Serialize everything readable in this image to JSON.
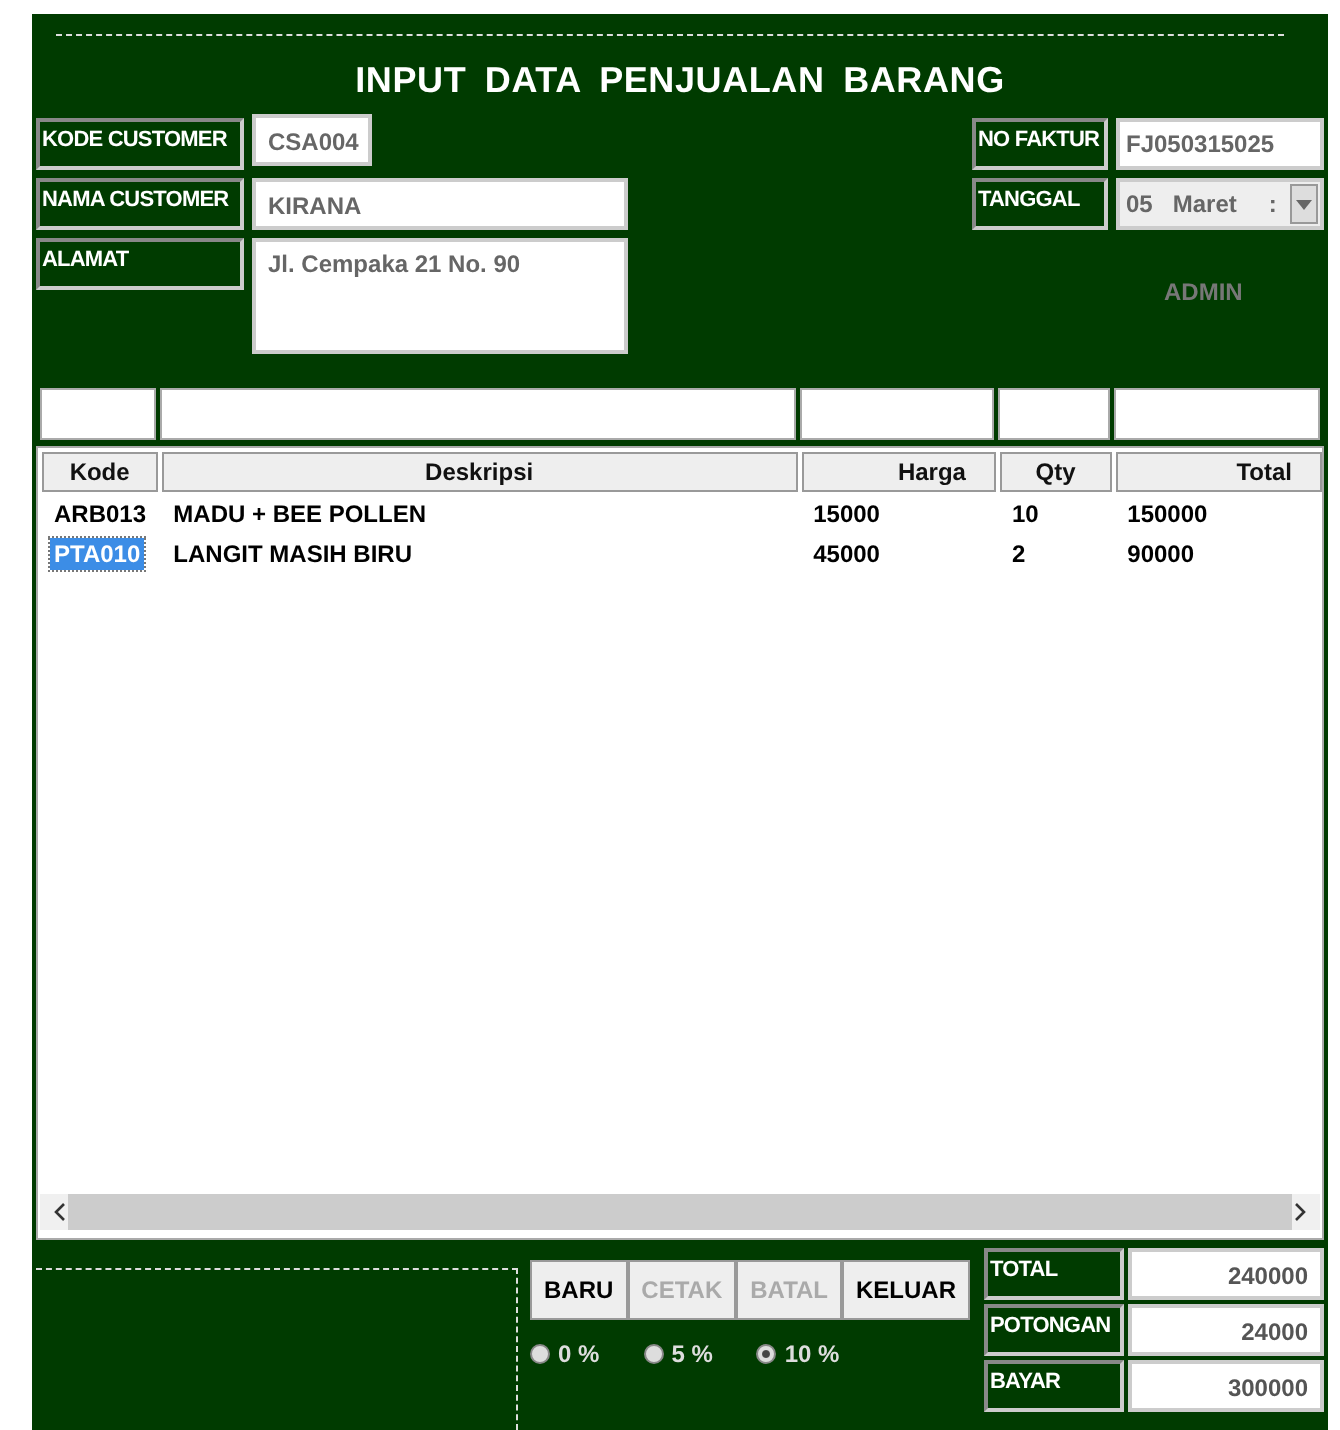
{
  "title": "INPUT DATA PENJUALAN BARANG",
  "customer": [
    {
      "label": "KODE CUSTOMER",
      "value": "CSA004",
      "kind": "short"
    },
    {
      "label": "NAMA CUSTOMER",
      "value": "KIRANA",
      "kind": "wide"
    },
    {
      "label": "ALAMAT",
      "value": "Jl. Cempaka 21 No. 90",
      "kind": "area"
    }
  ],
  "invoice": {
    "label": "NO FAKTUR",
    "value": "FJ050315025"
  },
  "date": {
    "label": "TANGGAL",
    "day": "05",
    "month": "Maret",
    "rest": ":"
  },
  "user": "ADMIN",
  "table": {
    "columns": [
      "Kode",
      "Deskripsi",
      "Harga",
      "Qty",
      "Total"
    ],
    "rows": [
      {
        "cells": [
          "ARB013",
          "MADU + BEE POLLEN",
          "15000",
          "10",
          "150000"
        ],
        "selected": false
      },
      {
        "cells": [
          "PTA010",
          "LANGIT MASIH BIRU",
          "45000",
          "2",
          "90000"
        ],
        "selected": true
      }
    ]
  },
  "buttons": [
    {
      "label": "BARU",
      "disabled": false
    },
    {
      "label": "CETAK",
      "disabled": true
    },
    {
      "label": "BATAL",
      "disabled": true
    },
    {
      "label": "KELUAR",
      "disabled": false
    }
  ],
  "discounts": [
    {
      "label": "0 %",
      "selected": false
    },
    {
      "label": "5 %",
      "selected": false
    },
    {
      "label": "10 %",
      "selected": true
    }
  ],
  "totals": [
    {
      "label": "TOTAL",
      "value": "240000"
    },
    {
      "label": "POTONGAN",
      "value": "24000"
    },
    {
      "label": "BAYAR",
      "value": "300000"
    }
  ]
}
